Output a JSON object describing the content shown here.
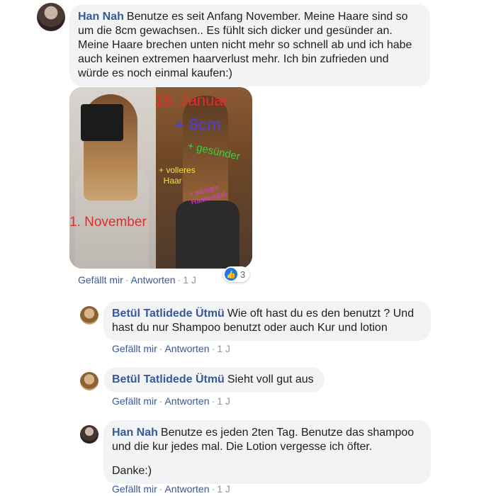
{
  "comments": [
    {
      "author": "Han Nah",
      "text": "Benutze es seit Anfang November. Meine Haare sind so um die 8cm gewachsen.. Es fühlt sich dicker und gesünder an. Meine Haare brechen unten nicht mehr so schnell ab und ich habe auch keinen extremen haarverlust mehr. Ich bin zufrieden und würde es noch einmal kaufen:)",
      "photo_labels": {
        "date_top": "18. Januar",
        "growth": "+ 8cm",
        "healthier": "+ gesünder",
        "fuller": "+ volleres",
        "fuller2": "Haar",
        "less_loss": "+ weniger",
        "less_loss2": "Haarausfall",
        "date_bottom": "1. November"
      },
      "reaction_count": "3",
      "like": "Gefällt mir",
      "reply": "Antworten",
      "time": "1 J"
    },
    {
      "author": "Betül Tatlidede Ütmü",
      "text": "Wie oft hast du es den benutzt ? Und hast du nur Shampoo benutzt oder auch Kur und lotion",
      "like": "Gefällt mir",
      "reply": "Antworten",
      "time": "1 J"
    },
    {
      "author": "Betül Tatlidede Ütmü",
      "text": "Sieht voll gut aus",
      "like": "Gefällt mir",
      "reply": "Antworten",
      "time": "1 J"
    },
    {
      "author": "Han Nah",
      "text": "Benutze es jeden 2ten Tag. Benutze das shampoo und die kur jedes mal. Die Lotion vergesse ich öfter.",
      "text2": "Danke:)",
      "like": "Gefällt mir",
      "reply": "Antworten",
      "time": "1 J"
    }
  ],
  "icons": {
    "like": "thumbs-up-icon"
  },
  "colors": {
    "author": "#385898",
    "bubble": "#f2f3f5",
    "meta": "#90949c",
    "like_blue": "#1877f2"
  }
}
